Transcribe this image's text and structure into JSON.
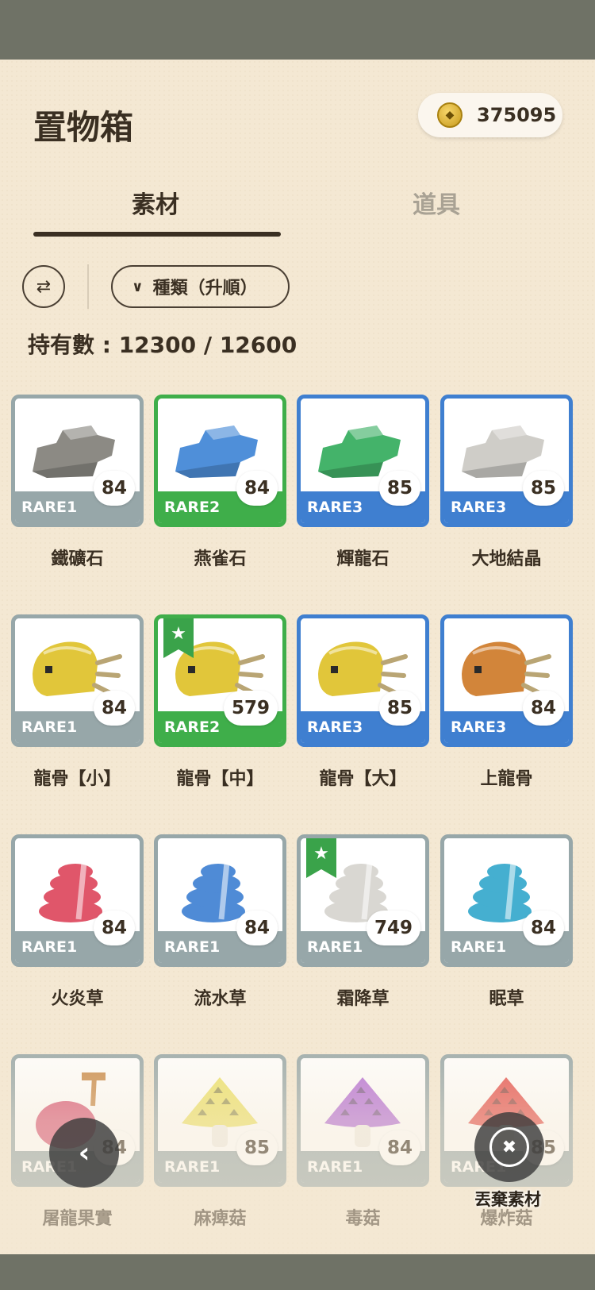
{
  "header": {
    "title": "置物箱",
    "coins": "375095",
    "coin_icon": "coin-icon"
  },
  "tabs": [
    {
      "label": "素材",
      "active": true
    },
    {
      "label": "道具",
      "active": false
    }
  ],
  "toolbar": {
    "swap_icon": "⇄",
    "sort_label": "種類（升順）"
  },
  "holding": "持有數 : 12300 / 12600",
  "colors": {
    "RARE1": "#97a7a9",
    "RARE2": "#3fae4a",
    "RARE3": "#3f7fd0",
    "fav": "#3aa34a"
  },
  "items": [
    {
      "name": "鐵礦石",
      "rare": "RARE1",
      "qty": "84",
      "fav": false,
      "shape": "ore",
      "color": "#8c8a84"
    },
    {
      "name": "燕雀石",
      "rare": "RARE2",
      "qty": "84",
      "fav": false,
      "shape": "ore",
      "color": "#4f8fd9"
    },
    {
      "name": "輝龍石",
      "rare": "RARE3",
      "qty": "85",
      "fav": false,
      "shape": "ore",
      "color": "#44b36a"
    },
    {
      "name": "大地結晶",
      "rare": "RARE3",
      "qty": "85",
      "fav": false,
      "shape": "ore",
      "color": "#cfcdc8"
    },
    {
      "name": "龍骨【小】",
      "rare": "RARE1",
      "qty": "84",
      "fav": false,
      "shape": "bone",
      "color": "#e1c63a"
    },
    {
      "name": "龍骨【中】",
      "rare": "RARE2",
      "qty": "579",
      "fav": true,
      "shape": "bone",
      "color": "#e1c63a"
    },
    {
      "name": "龍骨【大】",
      "rare": "RARE3",
      "qty": "85",
      "fav": false,
      "shape": "bone",
      "color": "#e1c63a"
    },
    {
      "name": "上龍骨",
      "rare": "RARE3",
      "qty": "84",
      "fav": false,
      "shape": "bone",
      "color": "#d2853a"
    },
    {
      "name": "火炎草",
      "rare": "RARE1",
      "qty": "84",
      "fav": false,
      "shape": "herb",
      "color": "#e0566a"
    },
    {
      "name": "流水草",
      "rare": "RARE1",
      "qty": "84",
      "fav": false,
      "shape": "herb",
      "color": "#4f8bd6"
    },
    {
      "name": "霜降草",
      "rare": "RARE1",
      "qty": "749",
      "fav": true,
      "shape": "herb",
      "color": "#d9d7d2"
    },
    {
      "name": "眠草",
      "rare": "RARE1",
      "qty": "84",
      "fav": false,
      "shape": "herb",
      "color": "#45afd0"
    },
    {
      "name": "屠龍果實",
      "rare": "RARE1",
      "qty": "84",
      "fav": false,
      "shape": "fruit",
      "color": "#d85a7a"
    },
    {
      "name": "麻痺菇",
      "rare": "RARE1",
      "qty": "85",
      "fav": false,
      "shape": "mushroom",
      "color": "#ece26a"
    },
    {
      "name": "毒菇",
      "rare": "RARE1",
      "qty": "84",
      "fav": false,
      "shape": "mushroom",
      "color": "#b46fd8"
    },
    {
      "name": "爆炸菇",
      "rare": "RARE1",
      "qty": "85",
      "fav": false,
      "shape": "mushroom",
      "color": "#e4524f"
    }
  ],
  "actions": {
    "back_icon": "‹",
    "discard_label": "丟棄素材",
    "discard_icon": "trash-monster-icon"
  }
}
